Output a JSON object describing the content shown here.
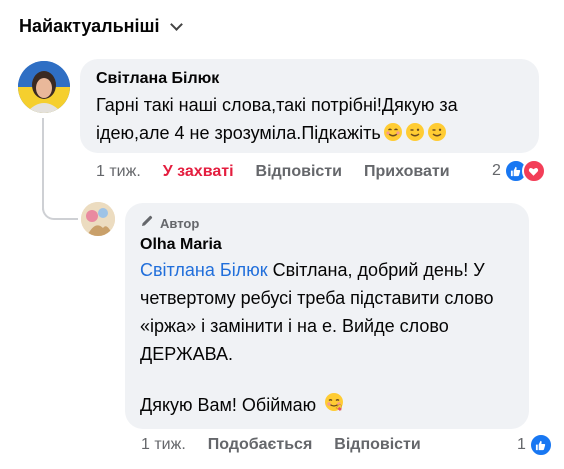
{
  "header": {
    "sort_label": "Найактуальніші"
  },
  "comments": [
    {
      "author": "Світлана Білюк",
      "text": "Гарні такі наші слова,такі потрібні!Дякую за ідею,але 4 не зрозуміла.Підкажіть",
      "time": "1 тиж.",
      "reacted_label": "У захваті",
      "reply_label": "Відповісти",
      "hide_label": "Приховати",
      "reaction_count": "2"
    },
    {
      "badge": "Автор",
      "author": "Olha Maria",
      "mention": "Світлана Білюк",
      "text": "Світлана, добрий день! У четвертому ребусі треба підставити слово «іржа» і замінити і на е. Вийде слово ДЕРЖАВА.",
      "thanks": "Дякую Вам! Обіймаю",
      "time": "1 тиж.",
      "like_label": "Подобається",
      "reply_label": "Відповісти",
      "reaction_count": "1"
    }
  ],
  "icons": {
    "sort": "chevron-down-icon",
    "author_badge": "pencil-icon",
    "like": "like-reaction-icon",
    "love": "love-reaction-icon",
    "emoji1": "blush-emoji-icon",
    "emoji2": "wink-emoji-icon",
    "emoji3": "hugging-face-emoji-icon"
  },
  "colors": {
    "reacted": "#e41e3f",
    "mention": "#216fdb",
    "bubble": "#f0f2f5",
    "like": "#1877f2",
    "love": "#f33e58"
  }
}
